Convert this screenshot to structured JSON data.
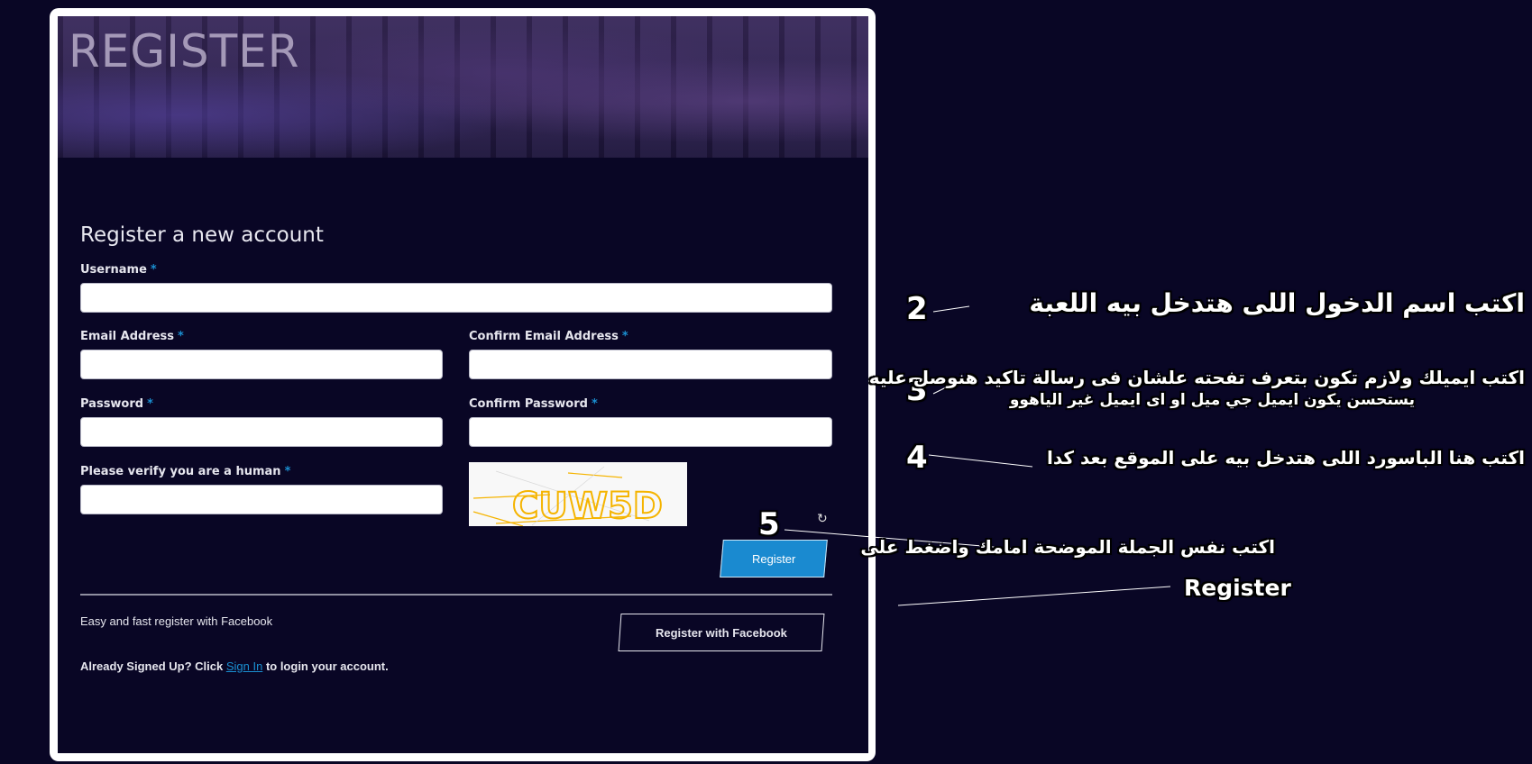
{
  "banner": {
    "title": "REGISTER"
  },
  "form": {
    "heading": "Register a new account",
    "required_marker": "*",
    "fields": {
      "username": {
        "label": "Username",
        "value": ""
      },
      "email": {
        "label": "Email Address",
        "value": ""
      },
      "confirm_email": {
        "label": "Confirm Email Address",
        "value": ""
      },
      "password": {
        "label": "Password",
        "value": ""
      },
      "confirm_password": {
        "label": "Confirm Password",
        "value": ""
      },
      "captcha": {
        "label": "Please verify you are a human",
        "value": ""
      }
    },
    "captcha_text": "CUW5D",
    "refresh_icon": "refresh-icon",
    "register_button": "Register",
    "facebook_text": "Easy and fast register with Facebook",
    "facebook_button": "Register with Facebook",
    "signin": {
      "prefix": "Already Signed Up? Click",
      "link": "Sign In",
      "suffix": "to login your account."
    }
  },
  "annotations": [
    {
      "number": "2",
      "text": "اكتب اسم الدخول اللى هتدخل بيه اللعبة"
    },
    {
      "number": "3",
      "text": "اكتب ايميلك ولازم تكون بتعرف تفحته علشان فى رسالة تاكيد هنوصل عليه",
      "subtext": "يستحسن يكون ايميل جي ميل او اى ايميل غير الياهوو"
    },
    {
      "number": "4",
      "text": "اكتب هنا الباسورد اللى هتدخل بيه على الموقع بعد كدا"
    },
    {
      "number": "5",
      "text": "اكتب نفس الجملة الموضحة امامك واضغط على",
      "subtext": "Register"
    }
  ],
  "colors": {
    "background": "#090625",
    "accent": "#1a8ad0",
    "required": "#1a8fd1",
    "captcha_text": "#f5b400"
  }
}
